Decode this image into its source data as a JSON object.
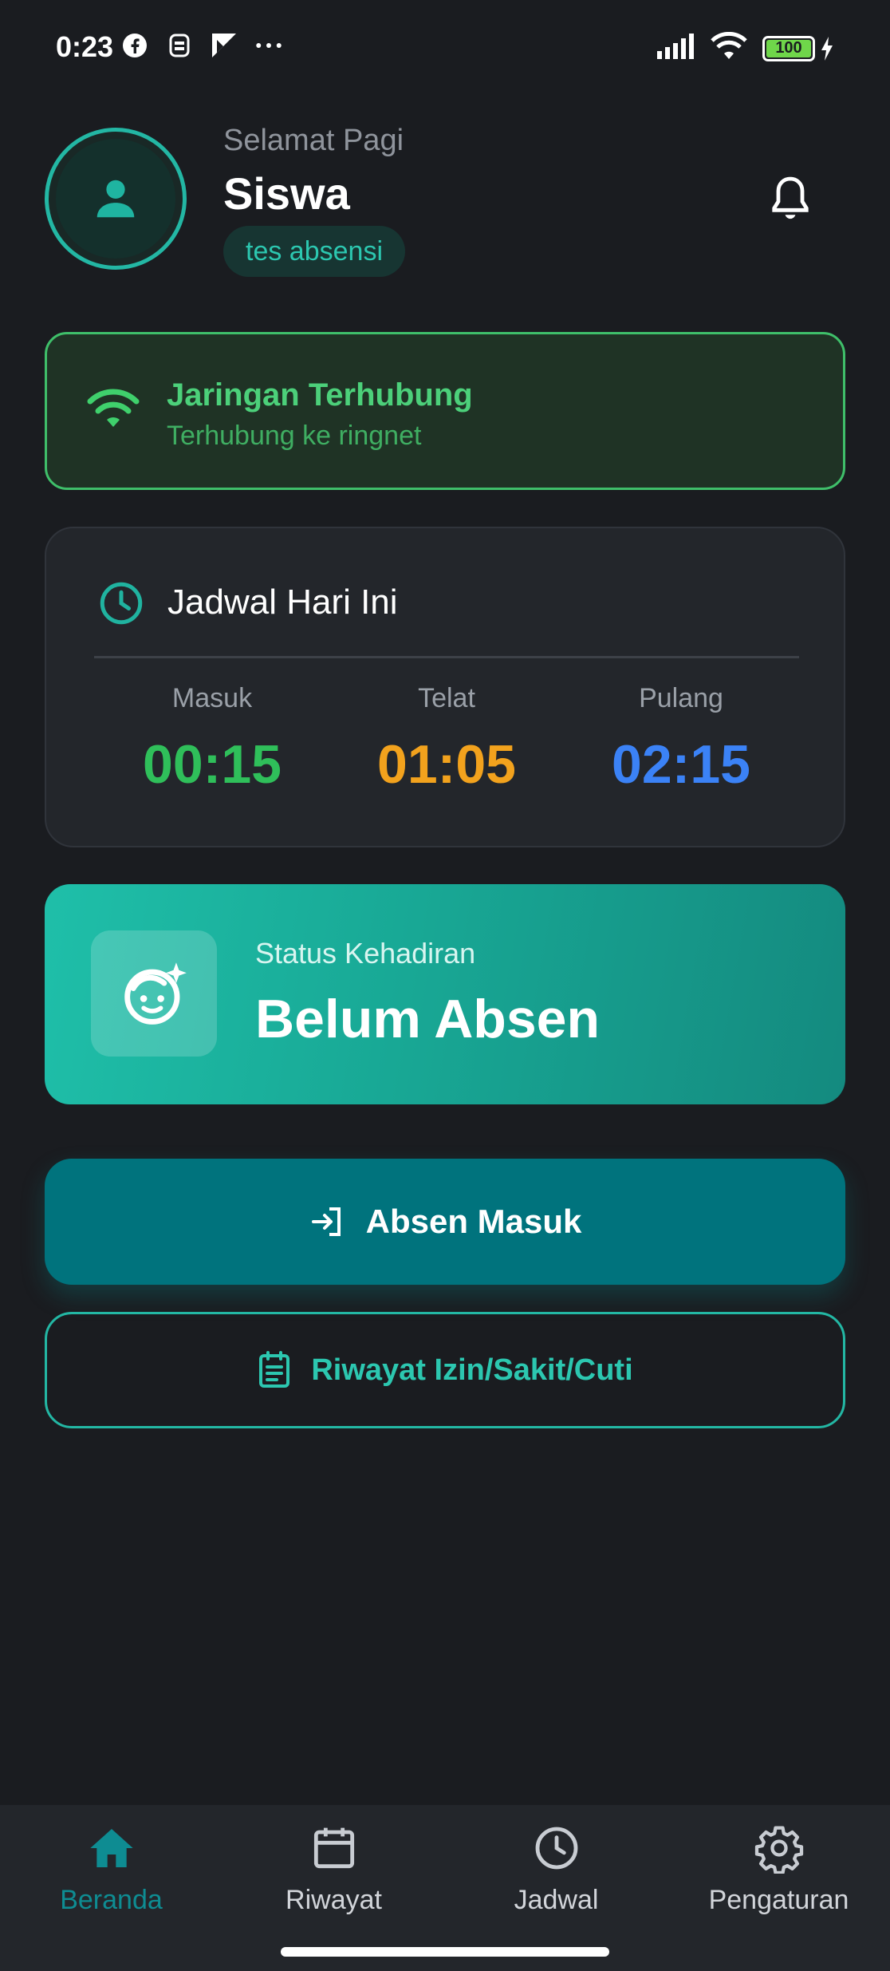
{
  "status_bar": {
    "time": "0:23",
    "battery": "100"
  },
  "header": {
    "greeting": "Selamat Pagi",
    "name": "Siswa",
    "class_badge": "tes absensi"
  },
  "network": {
    "title": "Jaringan Terhubung",
    "subtitle": "Terhubung ke ringnet"
  },
  "schedule": {
    "title": "Jadwal Hari Ini",
    "items": [
      {
        "label": "Masuk",
        "time": "00:15",
        "color": "#2fbf5a"
      },
      {
        "label": "Telat",
        "time": "01:05",
        "color": "#f2a21d"
      },
      {
        "label": "Pulang",
        "time": "02:15",
        "color": "#3b82f6"
      }
    ]
  },
  "attendance": {
    "label": "Status Kehadiran",
    "value": "Belum Absen"
  },
  "actions": {
    "check_in": "Absen Masuk",
    "leave_history": "Riwayat Izin/Sakit/Cuti"
  },
  "bottom_nav": {
    "items": [
      {
        "label": "Beranda",
        "icon": "home-icon",
        "active": true
      },
      {
        "label": "Riwayat",
        "icon": "calendar-icon",
        "active": false
      },
      {
        "label": "Jadwal",
        "icon": "clock-icon",
        "active": false
      },
      {
        "label": "Pengaturan",
        "icon": "gear-icon",
        "active": false
      }
    ]
  },
  "colors": {
    "accent": "#23b7a4",
    "network_green": "#4cd07a",
    "primary_button": "#00737d",
    "active_nav": "#0e8c92"
  }
}
